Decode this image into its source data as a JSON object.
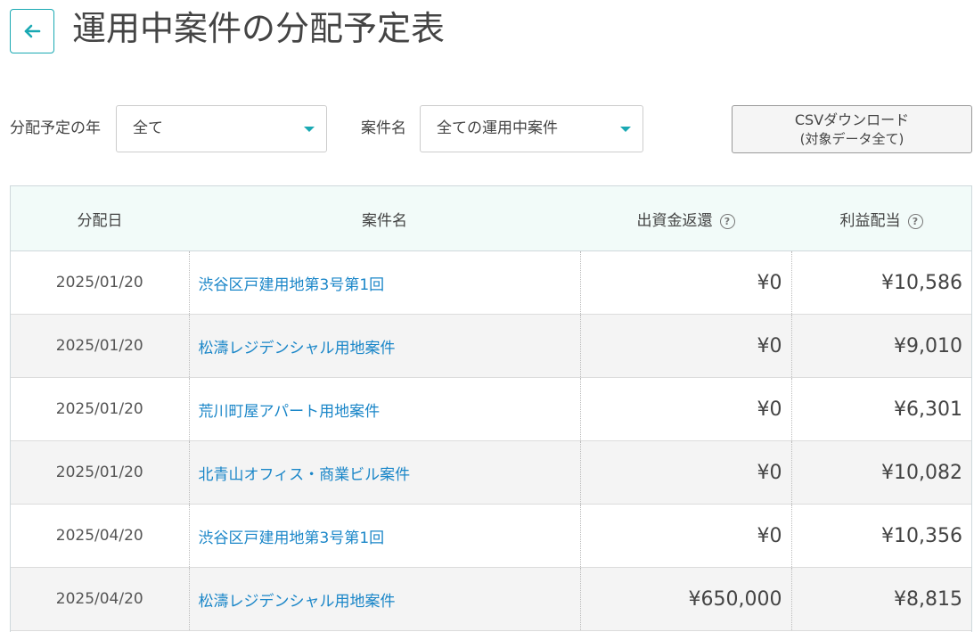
{
  "header": {
    "title": "運用中案件の分配予定表"
  },
  "filters": {
    "year_label": "分配予定の年",
    "year_value": "全て",
    "case_label": "案件名",
    "case_value": "全ての運用中案件"
  },
  "csv_button": {
    "line1": "CSVダウンロード",
    "line2": "(対象データ全て)"
  },
  "colors": {
    "accent": "#1aa9b3",
    "link": "#1a86c8",
    "header_bg": "#f2fbf9",
    "row_alt_bg": "#f4f4f4"
  },
  "table": {
    "columns": [
      "分配日",
      "案件名",
      "出資金返還",
      "利益配当"
    ],
    "help_icon": "?",
    "rows": [
      {
        "date": "2025/01/20",
        "name": "渋谷区戸建用地第3号第1回",
        "return": "¥0",
        "dividend": "¥10,586"
      },
      {
        "date": "2025/01/20",
        "name": "松濤レジデンシャル用地案件",
        "return": "¥0",
        "dividend": "¥9,010"
      },
      {
        "date": "2025/01/20",
        "name": "荒川町屋アパート用地案件",
        "return": "¥0",
        "dividend": "¥6,301"
      },
      {
        "date": "2025/01/20",
        "name": "北青山オフィス・商業ビル案件",
        "return": "¥0",
        "dividend": "¥10,082"
      },
      {
        "date": "2025/04/20",
        "name": "渋谷区戸建用地第3号第1回",
        "return": "¥0",
        "dividend": "¥10,356"
      },
      {
        "date": "2025/04/20",
        "name": "松濤レジデンシャル用地案件",
        "return": "¥650,000",
        "dividend": "¥8,815"
      }
    ]
  }
}
